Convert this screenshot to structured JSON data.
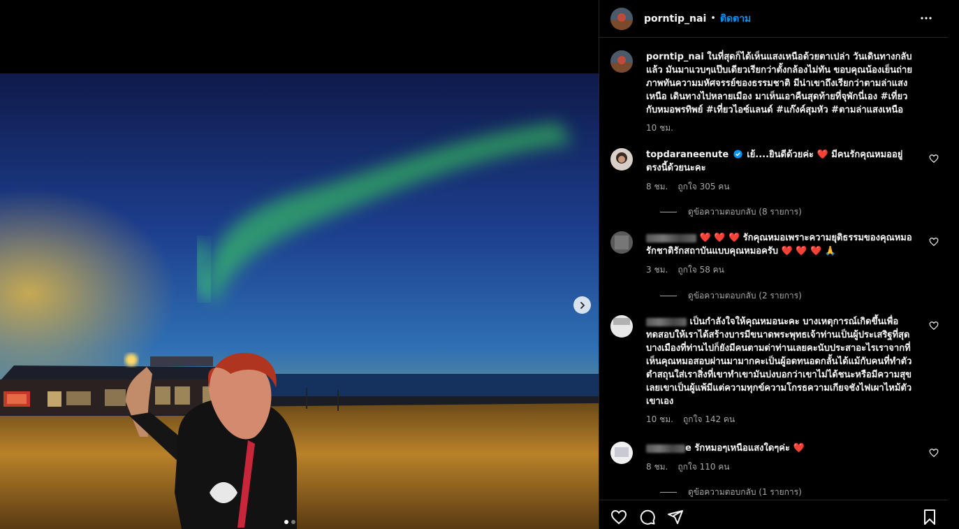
{
  "post": {
    "author": "porntip_nai",
    "separator": "•",
    "follow_label": "ติดตาม",
    "caption": "ในที่สุดก็ได้เห็นแสงเหนือด้วยตาเปล่า วันเดินทางกลับแล้ว มันมาแวบๆแป๊บเดียวเรียกว่าตั้งกล้องไม่ทัน ขอบคุณน้องเย็นถ่ายภาพทันความมหัศจรรย์ของธรรมชาติ มีน่าเขาถึงเรียกว่าตามล่าแสงเหนือ เดินทางไปหลายเมือง มาเห็นเอาคืนสุดท้ายที่จุพักนี่เอง #เที่ยวกับหมอพรทิพย์ #เที่ยวไอซ์แลนด์ #แก๊งค์สุมหัว #ตามล่าแสงเหนือ",
    "caption_time": "10 ชม."
  },
  "comments": [
    {
      "username": "topdaraneenute",
      "verified": true,
      "text": "เย้....ยินดีด้วยค่ะ ❤️ มีคนรักคุณหมออยู่ตรงนี้ด้วยนะคะ",
      "time": "8 ชม.",
      "likes": "ถูกใจ 305 คน",
      "replies": "ดูข้อความตอบกลับ (8 รายการ)"
    },
    {
      "username": "",
      "text": "❤️ ❤️ ❤️ รักคุณหมอเพราะความยุติธรรมของคุณหมอ รักชาติรักสถาบันแบบคุณหมอครับ ❤️ ❤️ ❤️ 🙏",
      "time": "3 ชม.",
      "likes": "ถูกใจ 58 คน",
      "replies": "ดูข้อความตอบกลับ (2 รายการ)"
    },
    {
      "username": "",
      "text": "เป็นกำลังใจให้คุณหมอนะคะ บางเหตุการณ์เกิดขึ้นเพื่อทดสอบให้เราได้สร้างบารมีขนาดพระพุทธเจ้าท่านเป็นผู้ประเสริฐที่สุด บางเมืองที่ท่านไปก็ยังมีคนตามด่าท่านเลยคะนับประสาอะไรเราจากที่เห็นคุณหมอสอบผ่านมามากคะเป็นผู้อดทนอดกลั้นได้แม้กับคนที่ทำตัวตำสถุนใส่เราสิ่งที่เขาทำเขามันบ่งบอกว่าเขาไม่ได้ชนะหรือมีความสุขเลยเขาเป็นผู้แพ้มีแต่ความทุกข์ความโกรธความเกียจชังไฟเผาไหม้ตัวเขาเอง",
      "time": "10 ชม.",
      "likes": "ถูกใจ 142 คน"
    },
    {
      "username": "",
      "name_suffix": "e",
      "text": "รักหมอๆเหนือแสงใดๆค่ะ ❤️",
      "time": "8 ชม.",
      "likes": "ถูกใจ 110 คน",
      "replies": "ดูข้อความตอบกลับ (1 รายการ)"
    }
  ],
  "carousel": {
    "current": 1,
    "total": 2
  },
  "icons": {
    "more": "more-options-icon",
    "next": "chevron-right-icon",
    "like": "heart-icon",
    "comment": "comment-icon",
    "share": "send-icon",
    "save": "bookmark-icon",
    "verified": "verified-badge-icon"
  },
  "colors": {
    "accent": "#0095f6",
    "heart": "#ff3040",
    "muted": "#a8a8a8",
    "verified": "#0095f6"
  }
}
